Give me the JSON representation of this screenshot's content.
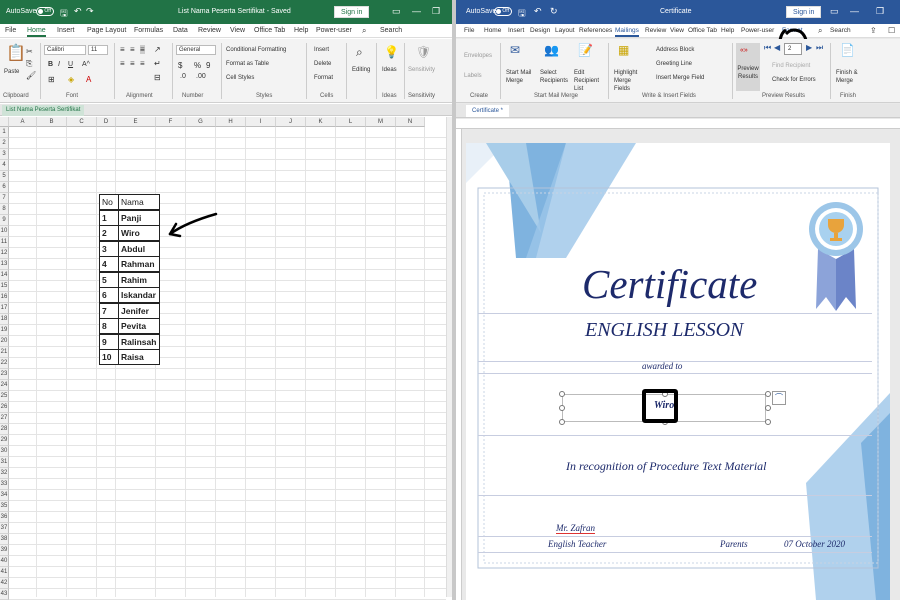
{
  "excel": {
    "autosave": "AutoSave",
    "autosave_state": "Off",
    "title": "List Nama Peserta Sertifikat  -  Saved",
    "search": "Search",
    "signin": "Sign in",
    "tabs": [
      "File",
      "Home",
      "Insert",
      "Page Layout",
      "Formulas",
      "Data",
      "Review",
      "View",
      "Office Tab",
      "Help",
      "Power-user"
    ],
    "font_name": "Calibri",
    "font_size": "11",
    "number_format": "General",
    "conditional_formatting": "Conditional Formatting",
    "format_as_table": "Format as Table",
    "cell_styles": "Cell Styles",
    "insert": "Insert",
    "delete": "Delete",
    "format": "Format",
    "editing": "Editing",
    "ideas": "Ideas",
    "sensitivity": "Sensitivity",
    "paste": "Paste",
    "groups": [
      "Clipboard",
      "Font",
      "Alignment",
      "Number",
      "Styles",
      "Cells",
      "Ideas",
      "Sensitivity"
    ],
    "sheet_tab": "List Nama Peserta Sertifikat",
    "columns": [
      "A",
      "B",
      "C",
      "D",
      "E",
      "F",
      "G",
      "H",
      "I",
      "J",
      "K",
      "L",
      "M",
      "N"
    ],
    "rows": [
      "1",
      "2",
      "3",
      "4",
      "5",
      "6",
      "7",
      "8",
      "9",
      "10",
      "11",
      "12",
      "13",
      "14",
      "15",
      "16",
      "17",
      "18",
      "19",
      "20",
      "21",
      "22",
      "23",
      "24",
      "25",
      "26",
      "27",
      "28",
      "29",
      "30",
      "31",
      "32",
      "33",
      "34",
      "35",
      "36",
      "37",
      "38",
      "39",
      "40",
      "41",
      "42",
      "43"
    ],
    "table_header": [
      "No",
      "Nama"
    ],
    "table": [
      [
        "1",
        "Panji"
      ],
      [
        "2",
        "Wiro"
      ],
      [
        "3",
        "Abdul"
      ],
      [
        "4",
        "Rahman"
      ],
      [
        "5",
        "Rahim"
      ],
      [
        "6",
        "Iskandar"
      ],
      [
        "7",
        "Jenifer"
      ],
      [
        "8",
        "Pevita"
      ],
      [
        "9",
        "Ralinsah"
      ],
      [
        "10",
        "Raisa"
      ]
    ]
  },
  "word": {
    "autosave": "AutoSave",
    "autosave_state": "Off",
    "title": "Certificate",
    "search": "Search",
    "signin": "Sign in",
    "tabs": [
      "File",
      "Home",
      "Insert",
      "Design",
      "Layout",
      "References",
      "Mailings",
      "Review",
      "View",
      "Office Tab",
      "Help",
      "Power-user",
      "Format"
    ],
    "envelopes": "Envelopes",
    "labels": "Labels",
    "start_mail_merge": "Start Mail Merge",
    "select_recipients": "Select Recipients",
    "edit_recipient_list": "Edit Recipient List",
    "highlight_merge_fields": "Highlight Merge Fields",
    "address_block": "Address Block",
    "greeting_line": "Greeting Line",
    "insert_merge_field": "Insert Merge Field",
    "preview_results": "Preview Results",
    "record_number": "2",
    "find_recipient": "Find Recipient",
    "check_for_errors": "Check for Errors",
    "finish_merge": "Finish & Merge",
    "groups": [
      "Create",
      "Start Mail Merge",
      "Write & Insert Fields",
      "Preview Results",
      "Finish"
    ],
    "doc_tab": "Certificate *",
    "cert": {
      "heading": "Certificate",
      "subheading": "ENGLISH LESSON",
      "awarded": "awarded to",
      "name": "Wiro",
      "recognition": "In recognition of Procedure Text Material",
      "signer": "Mr. Zafran",
      "signer_role": "English Teacher",
      "parents": "Parents",
      "date": "07 October 2020"
    }
  }
}
